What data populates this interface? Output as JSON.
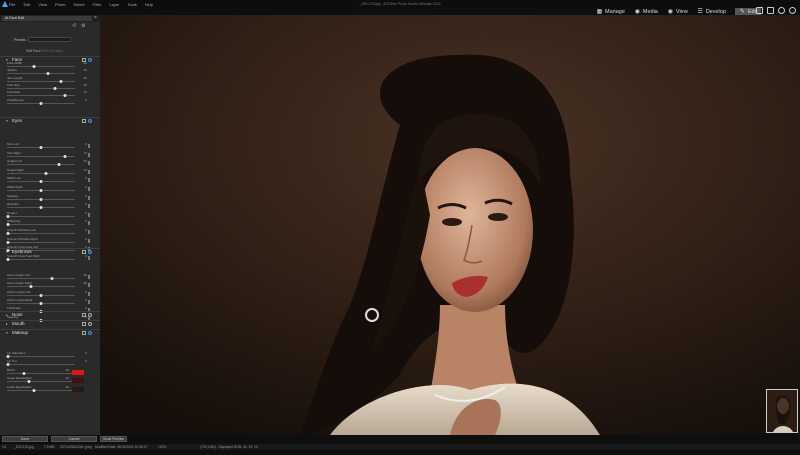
{
  "window": {
    "title": "_DSC133.jpg - ACDSee Photo Studio Ultimate 2023",
    "menu": [
      "File",
      "Edit",
      "View",
      "Photo",
      "Select",
      "Filter",
      "Layer",
      "Tools",
      "Help"
    ]
  },
  "modes": [
    {
      "label": "Manage",
      "icon": "grid-icon"
    },
    {
      "label": "Media",
      "icon": "eye-icon"
    },
    {
      "label": "View",
      "icon": "eye-icon"
    },
    {
      "label": "Develop",
      "icon": "sliders-icon"
    },
    {
      "label": "Edit",
      "icon": "brush-icon",
      "active": true
    }
  ],
  "panel": {
    "title": "AI Face Edit",
    "presets_label": "Presets",
    "presets_value": "",
    "edit_face_label": "Edit Face",
    "edit_from_faces_label": "Edit All Faces",
    "sections": {
      "face": {
        "title": "Face",
        "sliders": [
          {
            "label": "Face Width",
            "value": "-10",
            "pos": 0.4
          },
          {
            "label": "Jawline",
            "value": "20",
            "pos": 0.6
          },
          {
            "label": "Jaw Length",
            "value": "60",
            "pos": 0.8
          },
          {
            "label": "Chin Size",
            "value": "40",
            "pos": 0.7
          },
          {
            "label": "Forehead",
            "value": "70",
            "pos": 0.85
          },
          {
            "label": "Cheekbones",
            "value": "0",
            "pos": 0.5
          }
        ]
      },
      "eyes": {
        "title": "Eyes",
        "sliders": [
          {
            "label": "Size Left",
            "value": "0",
            "pos": 0.5
          },
          {
            "label": "Size Right",
            "value": "72",
            "pos": 0.86
          },
          {
            "label": "Height Left",
            "value": "54",
            "pos": 0.77
          },
          {
            "label": "Height Right",
            "value": "14",
            "pos": 0.57
          },
          {
            "label": "Width Left",
            "value": "0",
            "pos": 0.5
          },
          {
            "label": "Width Right",
            "value": "0",
            "pos": 0.5
          },
          {
            "label": "Spacing",
            "value": "0",
            "pos": 0.5
          },
          {
            "label": "Direction",
            "value": "0",
            "pos": 0.5
          },
          {
            "label": "Droplet",
            "value": "0",
            "pos": 0.02
          },
          {
            "label": "Whitening",
            "value": "0",
            "pos": 0.02
          },
          {
            "label": "Smooth Wrinkles Left",
            "value": "0",
            "pos": 0.02
          },
          {
            "label": "Smooth Wrinkles Right",
            "value": "0",
            "pos": 0.02
          },
          {
            "label": "Smooth Crow Feet Left",
            "value": "0",
            "pos": 0.02
          },
          {
            "label": "Smooth Crow Feet Right",
            "value": "0",
            "pos": 0.02
          }
        ]
      },
      "eyebrows": {
        "title": "Eyebrows",
        "sliders": [
          {
            "label": "Inner Length Left",
            "value": "32",
            "pos": 0.66
          },
          {
            "label": "Inner Length Right",
            "value": "-30",
            "pos": 0.35
          },
          {
            "label": "Outer Length Left",
            "value": "0",
            "pos": 0.5
          },
          {
            "label": "Outer Length Right",
            "value": "0",
            "pos": 0.5
          },
          {
            "label": "Thickness",
            "value": "0",
            "pos": 0.5
          },
          {
            "label": "Spacing",
            "value": "0",
            "pos": 0.5
          }
        ]
      },
      "nose": {
        "title": "Nose"
      },
      "mouth": {
        "title": "Mouth"
      },
      "makeup": {
        "title": "Makeup",
        "sliders": [
          {
            "label": "Lip Saturation",
            "value": "0",
            "pos": 0.02
          },
          {
            "label": "Lip Tint",
            "value": "0",
            "pos": 0.02
          },
          {
            "label": "Blush",
            "value": "25",
            "pos": 0.25,
            "swatch": "#d81b12"
          },
          {
            "label": "Upper Eyeshadow",
            "value": "32",
            "pos": 0.32,
            "swatch": "#3a1410"
          },
          {
            "label": "Lower Eyeshadow",
            "value": "40",
            "pos": 0.4,
            "swatch": "#2a1a12"
          }
        ]
      }
    },
    "done_label": "Done",
    "cancel_label": "Cancel"
  },
  "show_preview_label": "Show Preview",
  "status": {
    "index": "1/1",
    "filename": "_DSC133.jpg",
    "filesize": "7.9 MB",
    "dimensions": "3371x5082x24b .jpeg",
    "modified": "Modified Date: 08/31/2022 12:36:07",
    "zoom": "100%",
    "pixel": "(732,1180) - Displayed RGB: 42, 29, 20"
  },
  "colors": {
    "accent": "#3a8ee6",
    "panel_bg": "#2a2a2a"
  }
}
